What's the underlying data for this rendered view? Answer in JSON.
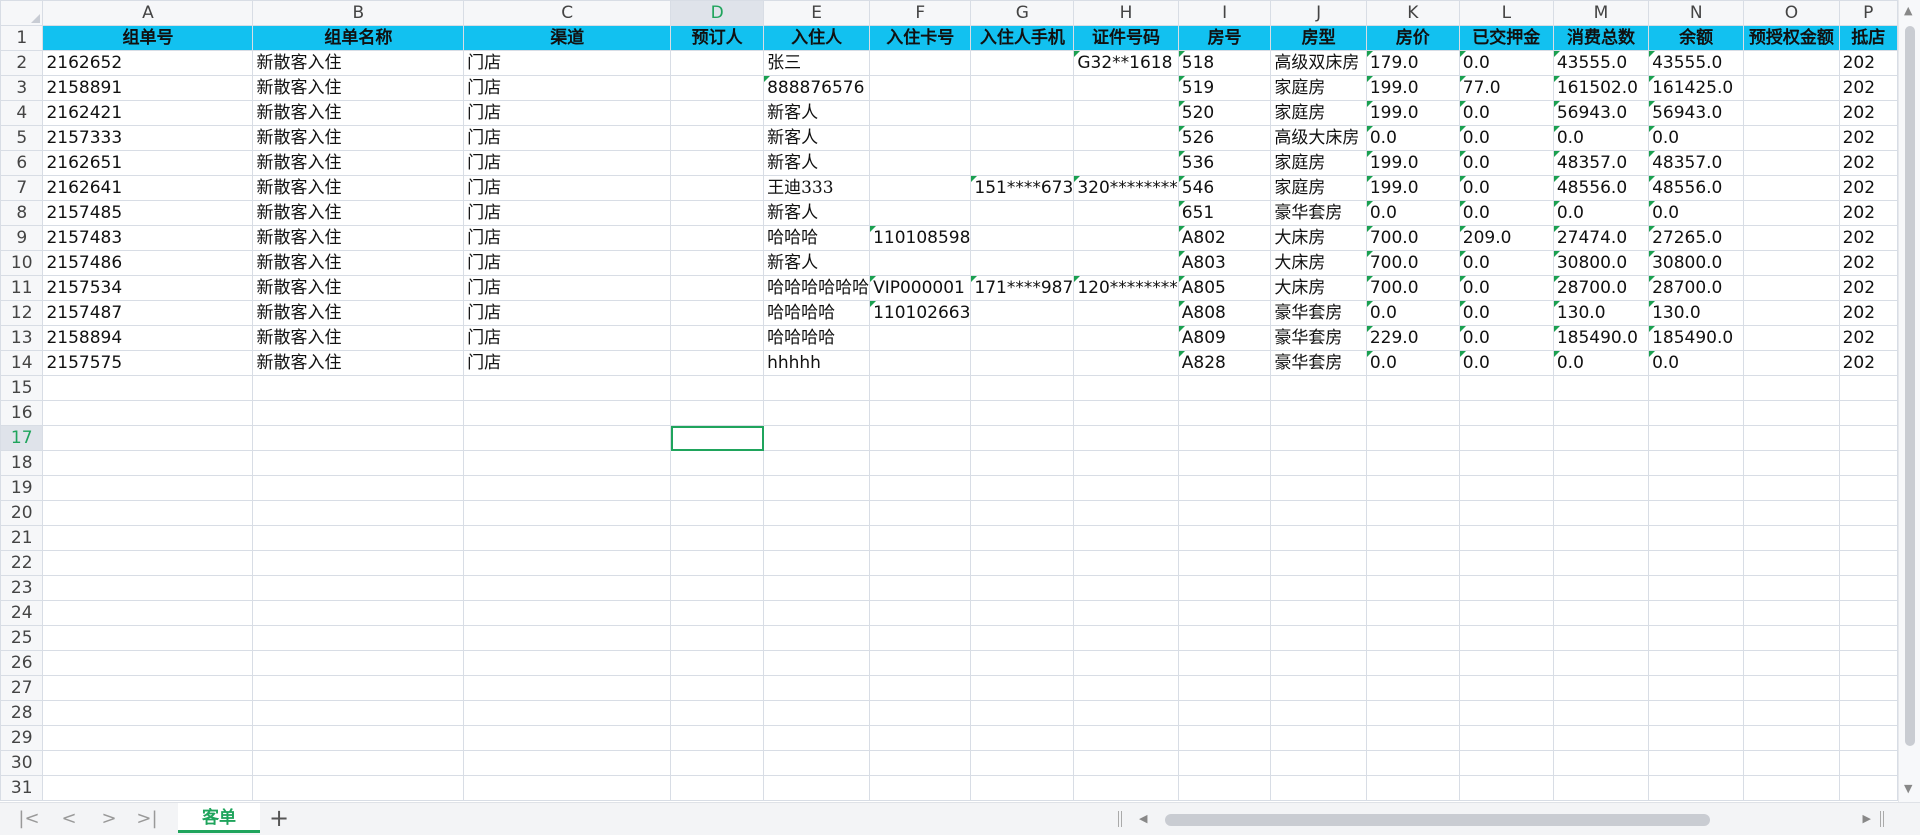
{
  "columns": [
    {
      "letter": "A",
      "w": 220
    },
    {
      "letter": "B",
      "w": 220
    },
    {
      "letter": "C",
      "w": 220
    },
    {
      "letter": "D",
      "w": 96
    },
    {
      "letter": "E",
      "w": 96
    },
    {
      "letter": "F",
      "w": 96
    },
    {
      "letter": "G",
      "w": 96
    },
    {
      "letter": "H",
      "w": 96
    },
    {
      "letter": "I",
      "w": 96
    },
    {
      "letter": "J",
      "w": 96
    },
    {
      "letter": "K",
      "w": 96
    },
    {
      "letter": "L",
      "w": 96
    },
    {
      "letter": "M",
      "w": 96
    },
    {
      "letter": "N",
      "w": 96
    },
    {
      "letter": "O",
      "w": 96
    },
    {
      "letter": "P",
      "w": 60
    }
  ],
  "selected_column": "D",
  "selected_row": 17,
  "active_cell": "D17",
  "header_row": [
    "组单号",
    "组单名称",
    "渠道",
    "预订人",
    "入住人",
    "入住卡号",
    "入住人手机",
    "证件号码",
    "房号",
    "房型",
    "房价",
    "已交押金",
    "消费总数",
    "余额",
    "预授权金额",
    "抵店"
  ],
  "rows": [
    [
      "2162652",
      "新散客入住",
      "门店",
      "",
      "张三",
      "",
      "",
      "G32**1618",
      "518",
      "高级双床房",
      "179.0",
      "0.0",
      "43555.0",
      "43555.0",
      "",
      "202"
    ],
    [
      "2158891",
      "新散客入住",
      "门店",
      "",
      "888876576",
      "",
      "",
      "",
      "519",
      "家庭房",
      "199.0",
      "77.0",
      "161502.0",
      "161425.0",
      "",
      "202"
    ],
    [
      "2162421",
      "新散客入住",
      "门店",
      "",
      "新客人",
      "",
      "",
      "",
      "520",
      "家庭房",
      "199.0",
      "0.0",
      "56943.0",
      "56943.0",
      "",
      "202"
    ],
    [
      "2157333",
      "新散客入住",
      "门店",
      "",
      "新客人",
      "",
      "",
      "",
      "526",
      "高级大床房",
      "0.0",
      "0.0",
      "0.0",
      "0.0",
      "",
      "202"
    ],
    [
      "2162651",
      "新散客入住",
      "门店",
      "",
      "新客人",
      "",
      "",
      "",
      "536",
      "家庭房",
      "199.0",
      "0.0",
      "48357.0",
      "48357.0",
      "",
      "202"
    ],
    [
      "2162641",
      "新散客入住",
      "门店",
      "",
      "王迪333",
      "",
      "151****673",
      "320********",
      "546",
      "家庭房",
      "199.0",
      "0.0",
      "48556.0",
      "48556.0",
      "",
      "202"
    ],
    [
      "2157485",
      "新散客入住",
      "门店",
      "",
      "新客人",
      "",
      "",
      "",
      "651",
      "豪华套房",
      "0.0",
      "0.0",
      "0.0",
      "0.0",
      "",
      "202"
    ],
    [
      "2157483",
      "新散客入住",
      "门店",
      "",
      "哈哈哈",
      "110108598",
      "",
      "",
      "A802",
      "大床房",
      "700.0",
      "209.0",
      "27474.0",
      "27265.0",
      "",
      "202"
    ],
    [
      "2157486",
      "新散客入住",
      "门店",
      "",
      "新客人",
      "",
      "",
      "",
      "A803",
      "大床房",
      "700.0",
      "0.0",
      "30800.0",
      "30800.0",
      "",
      "202"
    ],
    [
      "2157534",
      "新散客入住",
      "门店",
      "",
      "哈哈哈哈哈哈",
      "VIP000001",
      "171****987",
      "120********",
      "A805",
      "大床房",
      "700.0",
      "0.0",
      "28700.0",
      "28700.0",
      "",
      "202"
    ],
    [
      "2157487",
      "新散客入住",
      "门店",
      "",
      "哈哈哈哈",
      "110102663",
      "",
      "",
      "A808",
      "豪华套房",
      "0.0",
      "0.0",
      "130.0",
      "130.0",
      "",
      "202"
    ],
    [
      "2158894",
      "新散客入住",
      "门店",
      "",
      "哈哈哈哈",
      "",
      "",
      "",
      "A809",
      "豪华套房",
      "229.0",
      "0.0",
      "185490.0",
      "185490.0",
      "",
      "202"
    ],
    [
      "2157575",
      "新散客入住",
      "门店",
      "",
      "hhhhh",
      "",
      "",
      "",
      "A828",
      "豪华套房",
      "0.0",
      "0.0",
      "0.0",
      "0.0",
      "",
      "202"
    ]
  ],
  "total_rows": 31,
  "sheet_tabs": [
    "客单"
  ],
  "active_sheet": "客单"
}
